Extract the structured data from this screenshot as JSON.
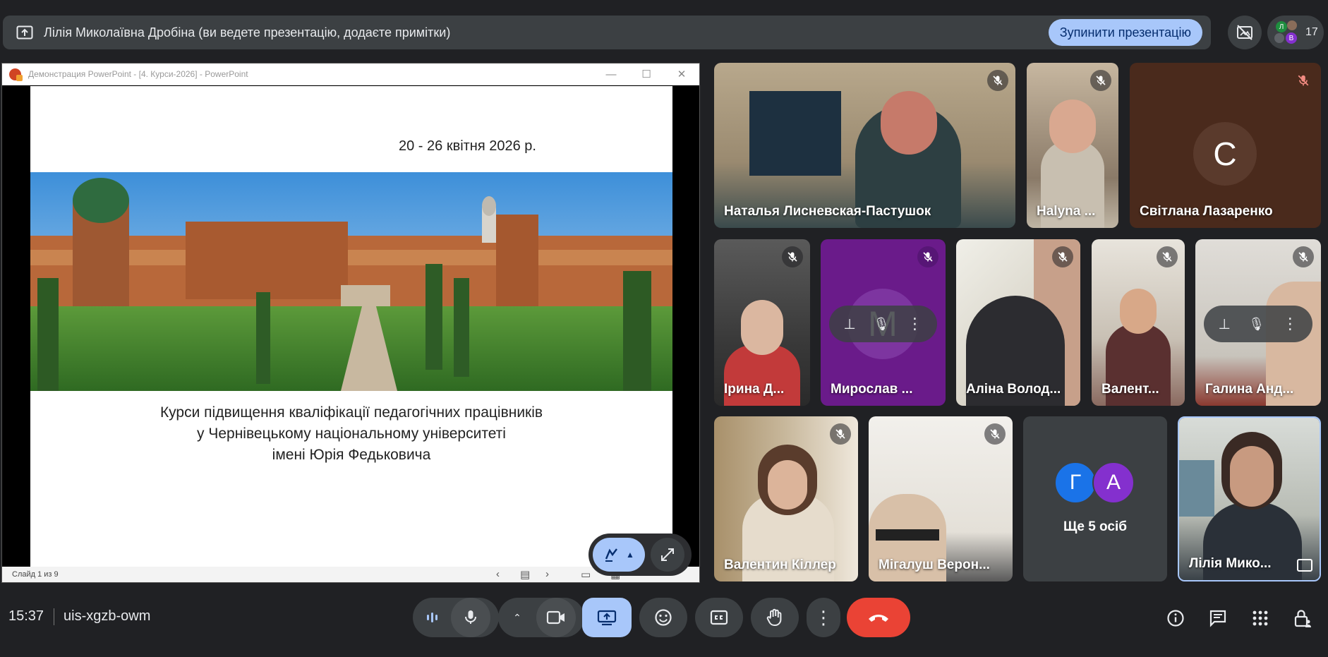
{
  "presenting_bar": {
    "title": "Лілія Миколаївна Дробіна (ви ведете презентацію, додаєте примітки)",
    "stop_label": "Зупинити презентацію",
    "participant_count": "17",
    "mini_avatars": [
      "Л",
      "В"
    ]
  },
  "ppt_window": {
    "title": "Демонстрация PowerPoint - [4. Курси-2026] - PowerPoint",
    "status": "Слайд 1 из 9"
  },
  "slide": {
    "date": "20 - 26 квітня 2026 р.",
    "lines": [
      "Курси підвищення кваліфікації педагогічних працівників",
      "у Чернівецькому національному університеті",
      "імені Юрія Федьковича"
    ]
  },
  "participants": [
    {
      "name": "Наталья Лисневская-Пастушок"
    },
    {
      "name": "Halyna ..."
    },
    {
      "name": "Світлана Лазаренко",
      "initial": "С"
    },
    {
      "name": "Ірина Д..."
    },
    {
      "name": "Мирослав ...",
      "initial": "М"
    },
    {
      "name": "Аліна Волод..."
    },
    {
      "name": "Валент..."
    },
    {
      "name": "Галина Анд..."
    },
    {
      "name": "Валентин Кіллер"
    },
    {
      "name": "Мігалуш Верон..."
    },
    {
      "name": "Лілія Мико..."
    }
  ],
  "more": {
    "label": "Ще 5 осіб",
    "initials": [
      "Г",
      "А"
    ]
  },
  "meeting": {
    "time": "15:37",
    "code": "uis-xgzb-owm"
  },
  "colors": {
    "accent": "#a8c7fa",
    "end_call": "#ea4335",
    "background": "#202124",
    "control": "#3c4043"
  }
}
